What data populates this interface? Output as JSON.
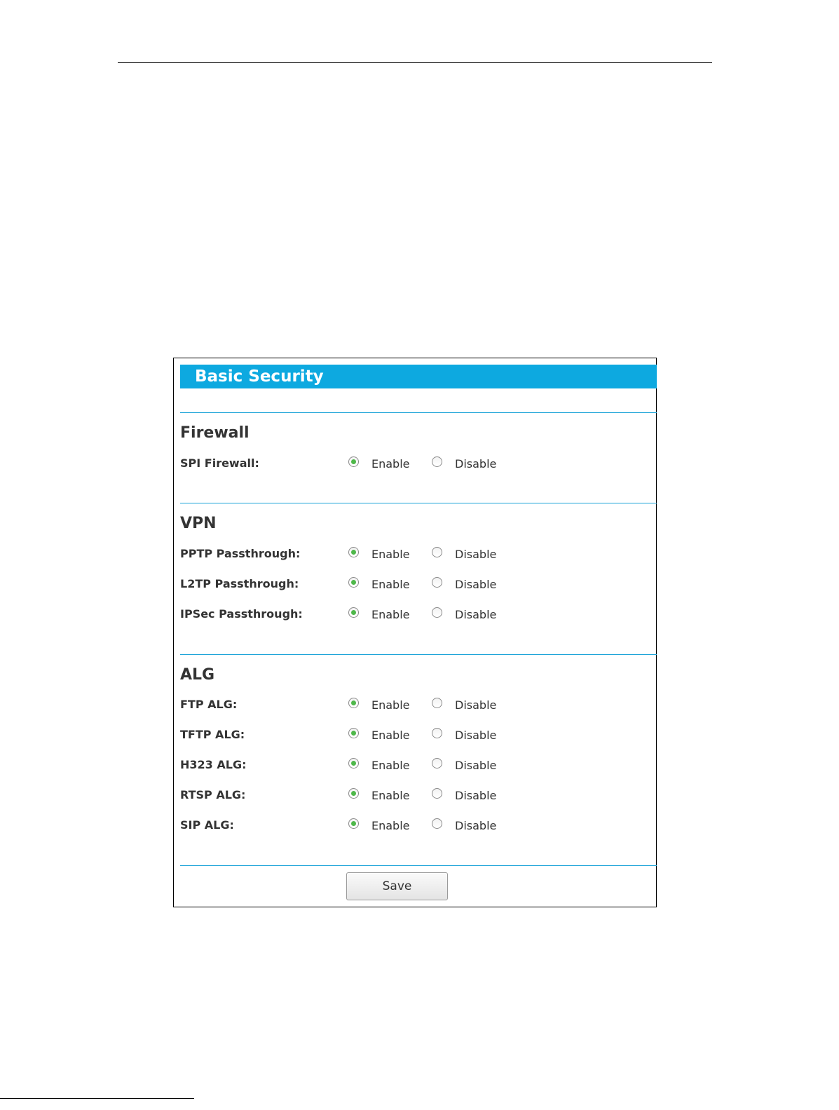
{
  "panel": {
    "title": "Basic Security"
  },
  "options": {
    "enable": "Enable",
    "disable": "Disable"
  },
  "sections": {
    "firewall": {
      "heading": "Firewall",
      "rows": [
        {
          "label": "SPI Firewall:",
          "value": "Enable"
        }
      ]
    },
    "vpn": {
      "heading": "VPN",
      "rows": [
        {
          "label": "PPTP Passthrough:",
          "value": "Enable"
        },
        {
          "label": "L2TP Passthrough:",
          "value": "Enable"
        },
        {
          "label": "IPSec Passthrough:",
          "value": "Enable"
        }
      ]
    },
    "alg": {
      "heading": "ALG",
      "rows": [
        {
          "label": "FTP ALG:",
          "value": "Enable"
        },
        {
          "label": "TFTP ALG:",
          "value": "Enable"
        },
        {
          "label": "H323 ALG:",
          "value": "Enable"
        },
        {
          "label": "RTSP ALG:",
          "value": "Enable"
        },
        {
          "label": "SIP ALG:",
          "value": "Enable"
        }
      ]
    }
  },
  "save_label": "Save",
  "colors": {
    "title_bar": "#0da9e0",
    "divider": "#1aa3d8",
    "radio_checked": "#4fb84a"
  }
}
